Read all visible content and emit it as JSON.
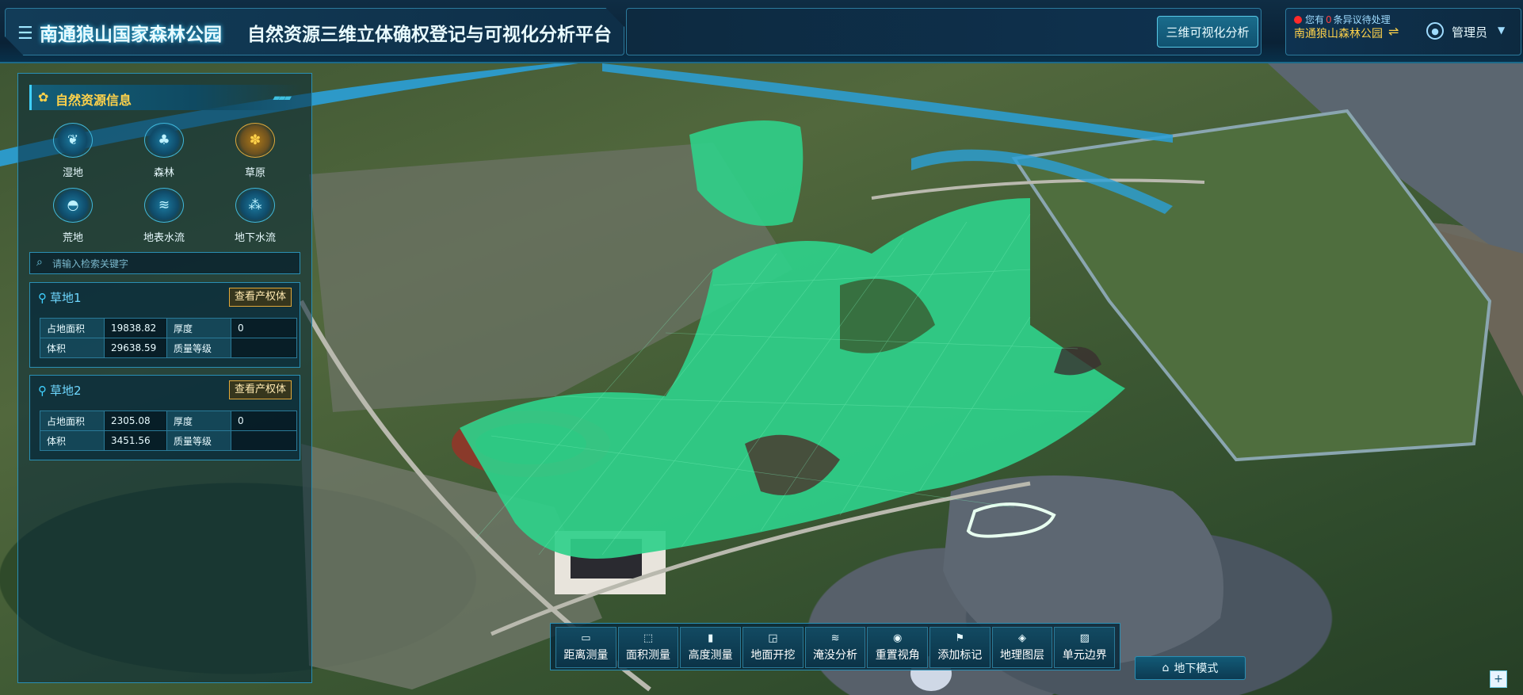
{
  "header": {
    "park_name": "南通狼山国家森林公园",
    "platform_name": "自然资源三维立体确权登记与可视化分析平台",
    "analysis_button": "三维可视化分析",
    "notice_prefix": "您有",
    "notice_count": "0",
    "notice_suffix": "条异议待处理",
    "org_name": "南通狼山森林公园",
    "admin_name": "管理员"
  },
  "panel": {
    "title": "自然资源信息",
    "categories": [
      {
        "label": "湿地",
        "icon": "wetland-icon",
        "active": false
      },
      {
        "label": "森林",
        "icon": "forest-icon",
        "active": false
      },
      {
        "label": "草原",
        "icon": "grassland-icon",
        "active": true
      },
      {
        "label": "荒地",
        "icon": "wasteland-icon",
        "active": false
      },
      {
        "label": "地表水流",
        "icon": "surface-water-icon",
        "active": false
      },
      {
        "label": "地下水流",
        "icon": "groundwater-icon",
        "active": false
      }
    ],
    "search_placeholder": "请输入检索关键字",
    "cards": [
      {
        "title": "草地1",
        "button": "查看产权体",
        "area_label": "占地面积",
        "area_value": "19838.82",
        "thickness_label": "厚度",
        "thickness_value": "0",
        "volume_label": "体积",
        "volume_value": "29638.59",
        "quality_label": "质量等级",
        "quality_value": ""
      },
      {
        "title": "草地2",
        "button": "查看产权体",
        "area_label": "占地面积",
        "area_value": "2305.08",
        "thickness_label": "厚度",
        "thickness_value": "0",
        "volume_label": "体积",
        "volume_value": "3451.56",
        "quality_label": "质量等级",
        "quality_value": ""
      }
    ]
  },
  "toolbar": {
    "tools": [
      {
        "label": "距离测量",
        "icon": "ruler-icon"
      },
      {
        "label": "面积测量",
        "icon": "area-icon"
      },
      {
        "label": "高度测量",
        "icon": "height-icon"
      },
      {
        "label": "地面开挖",
        "icon": "excavate-icon"
      },
      {
        "label": "淹没分析",
        "icon": "flood-icon"
      },
      {
        "label": "重置视角",
        "icon": "reset-view-icon"
      },
      {
        "label": "添加标记",
        "icon": "flag-icon"
      },
      {
        "label": "地理图层",
        "icon": "layers-icon"
      },
      {
        "label": "单元边界",
        "icon": "boundary-icon"
      }
    ],
    "underground_mode": "地下模式"
  },
  "colors": {
    "accent": "#3fd0ff",
    "highlight": "#ffd24a",
    "mesh_green": "#2fd08a"
  }
}
